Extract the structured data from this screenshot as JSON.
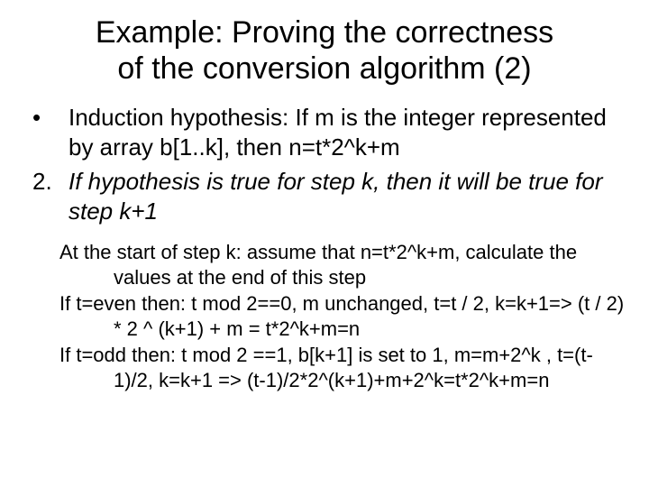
{
  "title_line1": "Example: Proving the correctness",
  "title_line2": "of  the  conversion algorithm (2)",
  "bullets": [
    {
      "marker": "•",
      "text": "Induction hypothesis: If m is the integer represented by array b[1..k], then n=t*2^k+m",
      "italic": false
    },
    {
      "marker": "2.",
      "text": "If hypothesis is true for step k, then it will be true for step k+1",
      "italic": true
    }
  ],
  "proof": [
    "At the start of step k: assume that n=t*2^k+m, calculate the values at the end of this step",
    "If t=even then:  t mod 2==0,  m unchanged, t=t / 2, k=k+1=> (t / 2) * 2 ^ (k+1) + m = t*2^k+m=n",
    "If t=odd then: t mod 2 ==1, b[k+1] is set to 1, m=m+2^k , t=(t-1)/2, k=k+1 => (t-1)/2*2^(k+1)+m+2^k=t*2^k+m=n"
  ]
}
